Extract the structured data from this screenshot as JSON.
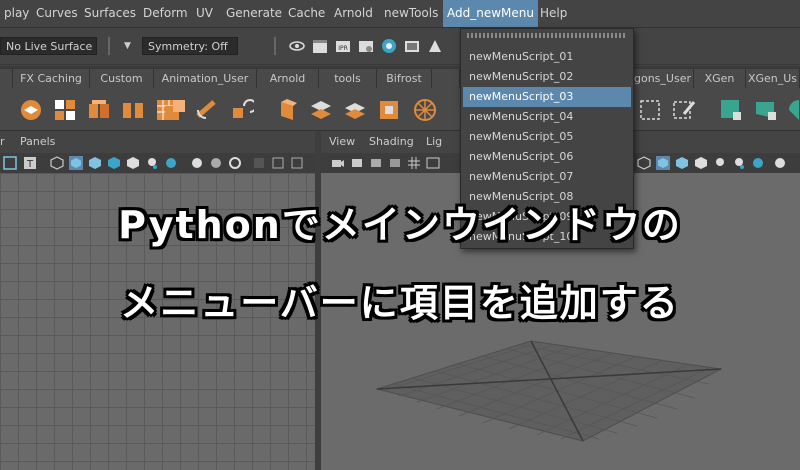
{
  "menubar": {
    "items": [
      "play",
      "Curves",
      "Surfaces",
      "Deform",
      "UV",
      "Generate",
      "Cache",
      "Arnold",
      "newTools",
      "Add_newMenu",
      "Help"
    ],
    "active_index": 9
  },
  "statusline": {
    "selection_mode": "No Live Surface",
    "symmetry": "Symmetry: Off"
  },
  "shelf_tabs": [
    "",
    "FX Caching",
    "Custom",
    "Animation_User",
    "Arnold",
    "tools",
    "Bifrost",
    "",
    "gons_User",
    "XGen",
    "XGen_Us"
  ],
  "viewport_left": {
    "menus": [
      "r",
      "Panels"
    ]
  },
  "viewport_right": {
    "menus": [
      "View",
      "Shading",
      "Lig"
    ]
  },
  "dropdown": {
    "items": [
      "newMenuScript_01",
      "newMenuScript_02",
      "newMenuScript_03",
      "newMenuScript_04",
      "newMenuScript_05",
      "newMenuScript_06",
      "newMenuScript_07",
      "newMenuScript_08",
      "newMenuScript_09",
      "newMenuScript_10"
    ],
    "highlighted_index": 2
  },
  "overlay": {
    "line1": "Pythonでメインウインドウの",
    "line2": "メニューバーに項目を追加する"
  },
  "colors": {
    "accent": "#5d88ad",
    "shelf_icon_orange": "#e08a3c",
    "shelf_icon_teal": "#3aa58f",
    "panel": "#444444",
    "viewport": "#6a6a6a"
  }
}
